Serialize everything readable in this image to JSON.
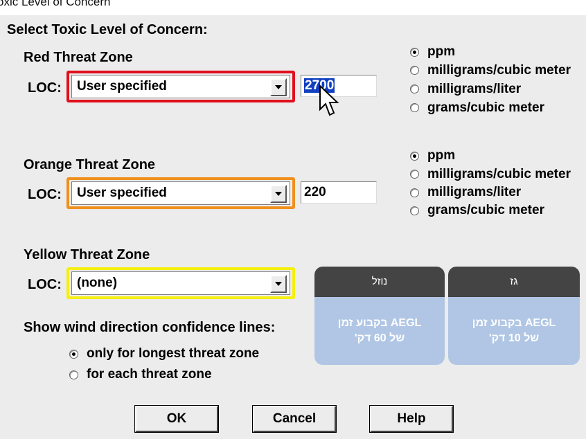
{
  "window": {
    "title": "oxic Level of Concern"
  },
  "heading": "Select Toxic Level of Concern:",
  "zones": {
    "red": {
      "title": "Red Threat Zone",
      "loc_label": "LOC:",
      "select_value": "User specified",
      "input_value": "2700",
      "units": [
        "ppm",
        "milligrams/cubic meter",
        "milligrams/liter",
        "grams/cubic meter"
      ],
      "selected_unit": "ppm",
      "color": "#e0101c"
    },
    "orange": {
      "title": "Orange Threat Zone",
      "loc_label": "LOC:",
      "select_value": "User specified",
      "input_value": "220",
      "units": [
        "ppm",
        "milligrams/cubic meter",
        "milligrams/liter",
        "grams/cubic meter"
      ],
      "selected_unit": "ppm",
      "color": "#f0901c"
    },
    "yellow": {
      "title": "Yellow Threat Zone",
      "loc_label": "LOC:",
      "select_value": "(none)",
      "color": "#f5f010"
    }
  },
  "confidence": {
    "label": "Show wind direction confidence lines:",
    "options": [
      "only for longest threat zone",
      "for each threat zone"
    ],
    "selected": "only for longest threat zone"
  },
  "buttons": {
    "ok": "OK",
    "cancel": "Cancel",
    "help": "Help"
  },
  "overlay": {
    "cards": [
      {
        "header": "נוזל",
        "line1": "AEGL בקבוע זמן",
        "line2": "של 60 דק'"
      },
      {
        "header": "גז",
        "line1": "AEGL בקבוע זמן",
        "line2": "של 10 דק'"
      }
    ],
    "header_color": "#444444",
    "body_color": "#b0c6e4"
  },
  "icons": {
    "cursor": "pointer-arrow-icon",
    "dropdown": "chevron-down-icon",
    "radio": "radio-icon"
  }
}
